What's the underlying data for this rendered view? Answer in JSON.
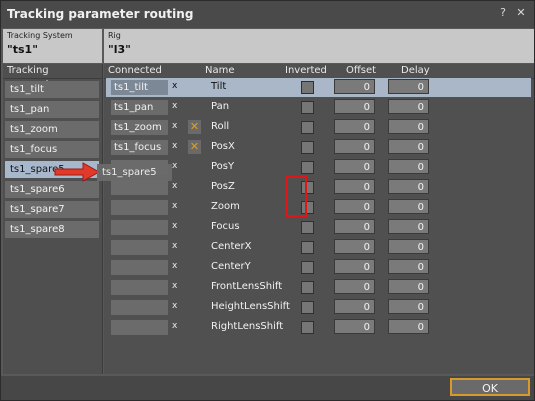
{
  "window": {
    "title": "Tracking parameter routing",
    "help": "?",
    "close": "✕"
  },
  "tracking_system": {
    "label": "Tracking System",
    "value": "\"ts1\""
  },
  "rig": {
    "label": "Rig",
    "value": "\"l3\""
  },
  "left": {
    "header": "Tracking parameter",
    "items": [
      "ts1_tilt",
      "ts1_pan",
      "ts1_zoom",
      "ts1_focus",
      "ts1_spare5",
      "ts1_spare6",
      "ts1_spare7",
      "ts1_spare8"
    ],
    "selected": "ts1_spare5"
  },
  "columns": {
    "connected": "Connected",
    "name": "Name",
    "inverted": "Inverted",
    "offset": "Offset",
    "delay": "Delay"
  },
  "rows": [
    {
      "connected": "ts1_tilt",
      "x": "x",
      "name": "Tilt",
      "offset": "0",
      "delay": "0",
      "highlight": true
    },
    {
      "connected": "ts1_pan",
      "x": "x",
      "name": "Pan",
      "offset": "0",
      "delay": "0"
    },
    {
      "connected": "ts1_zoom",
      "x": "x",
      "name": "Roll",
      "offset": "0",
      "delay": "0",
      "locked": true
    },
    {
      "connected": "ts1_focus",
      "x": "x",
      "name": "PosX",
      "offset": "0",
      "delay": "0",
      "locked": true
    },
    {
      "connected": "",
      "x": "x",
      "name": "PosY",
      "offset": "0",
      "delay": "0"
    },
    {
      "connected": "",
      "x": "x",
      "name": "PosZ",
      "offset": "0",
      "delay": "0"
    },
    {
      "connected": "",
      "x": "x",
      "name": "Zoom",
      "offset": "0",
      "delay": "0"
    },
    {
      "connected": "",
      "x": "x",
      "name": "Focus",
      "offset": "0",
      "delay": "0"
    },
    {
      "connected": "",
      "x": "x",
      "name": "CenterX",
      "offset": "0",
      "delay": "0"
    },
    {
      "connected": "",
      "x": "x",
      "name": "CenterY",
      "offset": "0",
      "delay": "0"
    },
    {
      "connected": "",
      "x": "x",
      "name": "FrontLensShift",
      "offset": "0",
      "delay": "0"
    },
    {
      "connected": "",
      "x": "x",
      "name": "HeightLensShift",
      "offset": "0",
      "delay": "0"
    },
    {
      "connected": "",
      "x": "x",
      "name": "RightLensShift",
      "offset": "0",
      "delay": "0"
    }
  ],
  "drag_item": "ts1_spare5",
  "lock_icon_glyph": "✕",
  "ok_label": "OK",
  "colors": {
    "selection": "#a7b7cc",
    "focus_border": "#d99a2b",
    "annotation": "#e01616"
  }
}
